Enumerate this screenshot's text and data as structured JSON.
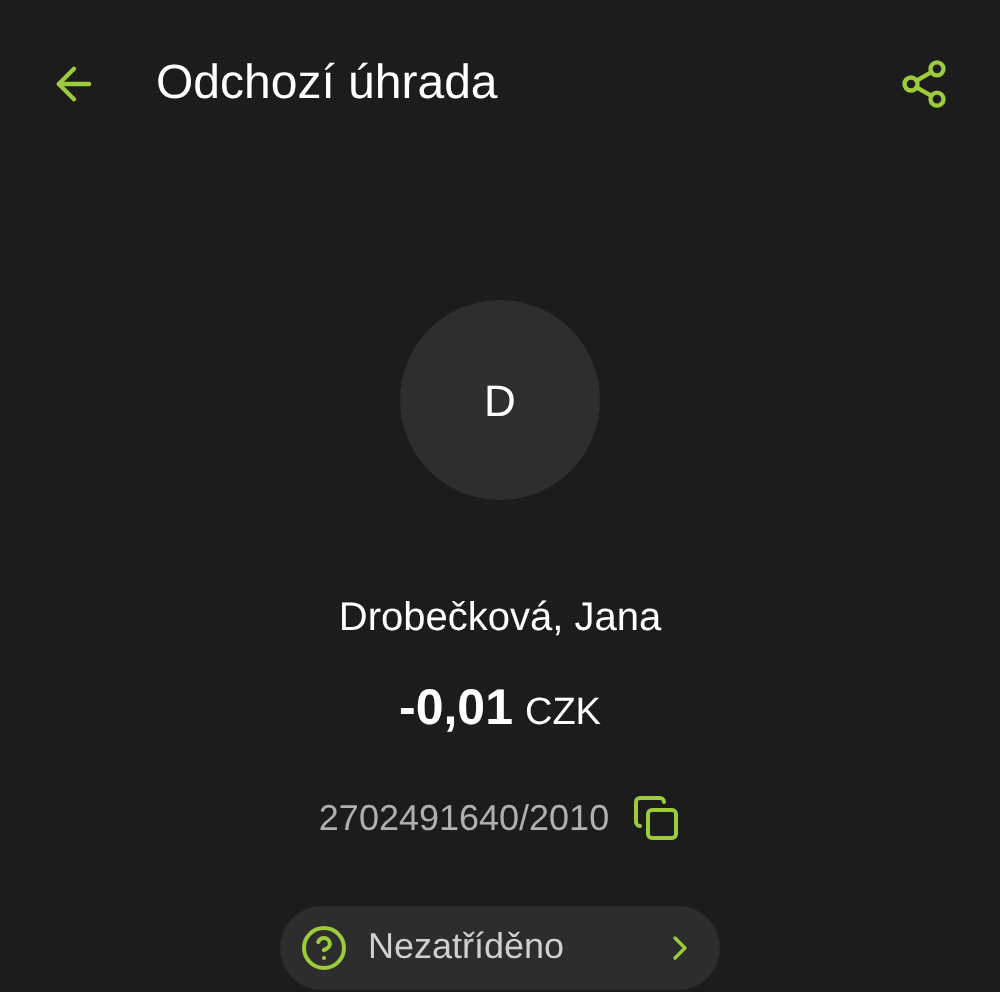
{
  "header": {
    "title": "Odchozí úhrada"
  },
  "payee": {
    "initial": "D",
    "name": "Drobečková, Jana",
    "amount": "-0,01",
    "currency": "CZK",
    "account": "2702491640/2010"
  },
  "category": {
    "label": "Nezatříděno"
  }
}
